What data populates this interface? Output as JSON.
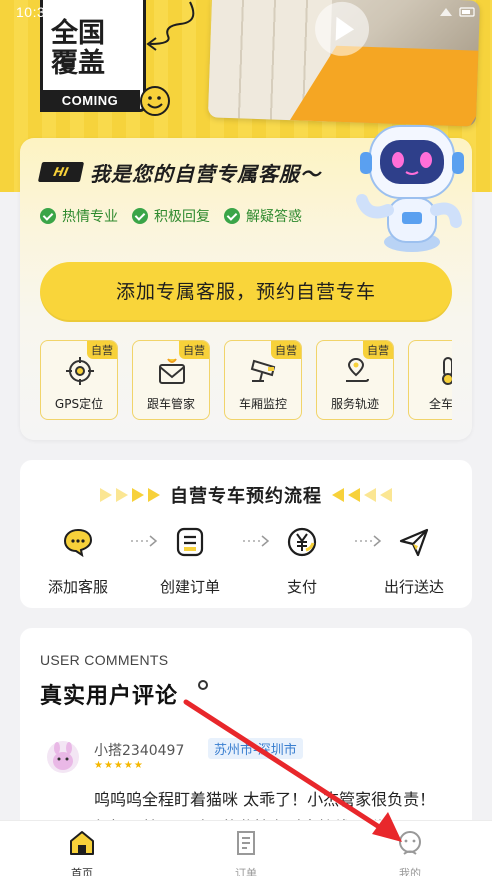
{
  "status_bar": {
    "time": "10:35"
  },
  "hero": {
    "promo_big": "全国\n覆盖",
    "promo_small": "COMING",
    "video_label": "play-video"
  },
  "service": {
    "badge": "HI",
    "title": "我是您的自营专属客服～",
    "features": [
      "热情专业",
      "积极回复",
      "解疑答惑"
    ],
    "cta": "添加专属客服，预约自营专车",
    "tools": [
      {
        "label": "GPS定位",
        "tag": "自营",
        "icon": "gps-icon"
      },
      {
        "label": "跟车管家",
        "tag": "自营",
        "icon": "envelope-gift-icon"
      },
      {
        "label": "车厢监控",
        "tag": "自营",
        "icon": "camera-icon"
      },
      {
        "label": "服务轨迹",
        "tag": "自营",
        "icon": "route-icon"
      },
      {
        "label": "全车温",
        "tag": "自营",
        "icon": "thermometer-icon"
      }
    ]
  },
  "process": {
    "title": "自营专车预约流程",
    "steps": [
      {
        "label": "添加客服",
        "icon": "chat-icon"
      },
      {
        "label": "创建订单",
        "icon": "order-icon"
      },
      {
        "label": "支付",
        "icon": "yuan-icon"
      },
      {
        "label": "出行送达",
        "icon": "paper-plane-icon"
      }
    ]
  },
  "comments": {
    "eyebrow": "USER COMMENTS",
    "title": "真实用户评论",
    "items": [
      {
        "user": "小搭2340497",
        "location": "苏州市-深圳市",
        "stars": "★★★★★",
        "text": "呜呜呜全程盯着猫咪 太乖了！小杰管家很负责！很好！就是一时一的监控有时中护线一群"
      }
    ]
  },
  "tabbar": {
    "items": [
      {
        "label": "首页",
        "icon": "home-icon",
        "active": true
      },
      {
        "label": "订单",
        "icon": "order-list-icon",
        "active": false
      },
      {
        "label": "我的",
        "icon": "profile-icon",
        "active": false
      }
    ]
  },
  "colors": {
    "brand_yellow": "#f7d13a",
    "accent_green": "#3aa548",
    "annotation_red": "#e8272b"
  }
}
